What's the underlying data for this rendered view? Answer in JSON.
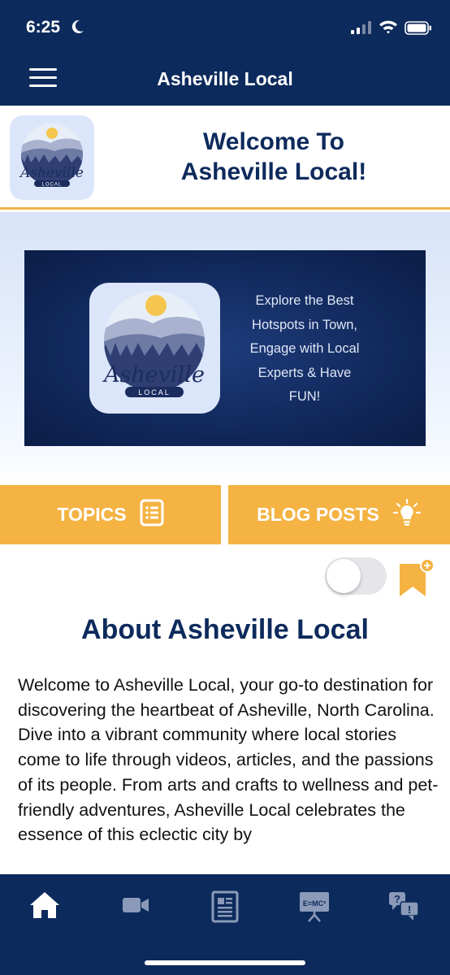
{
  "status_bar": {
    "time": "6:25"
  },
  "header": {
    "title": "Asheville Local"
  },
  "welcome": {
    "title_line1": "Welcome To",
    "title_line2": "Asheville Local!"
  },
  "banner": {
    "logo_text": "Asheville",
    "logo_subtext": "LOCAL",
    "lines": [
      "Explore the Best",
      "Hotspots in Town,",
      "Engage with Local",
      "Experts & Have",
      "FUN!"
    ]
  },
  "buttons": {
    "topics": "TOPICS",
    "blog_posts": "BLOG POSTS"
  },
  "about": {
    "title": "About Asheville Local",
    "body": "Welcome to Asheville Local, your go-to destination for discovering the heartbeat of Asheville, North Carolina. Dive into a vibrant community where local stories come to life through videos, articles, and the passions of its people. From arts and crafts to wellness and pet-friendly adventures, Asheville Local celebrates the essence of this eclectic city by"
  },
  "bottom_nav": {
    "items": [
      "home-icon",
      "video-icon",
      "article-icon",
      "presentation-icon",
      "qa-icon"
    ],
    "presentation_label": "E=MC²"
  },
  "colors": {
    "navy": "#0d2a5c",
    "accent": "#f4b343",
    "banner": "#0f2556"
  }
}
